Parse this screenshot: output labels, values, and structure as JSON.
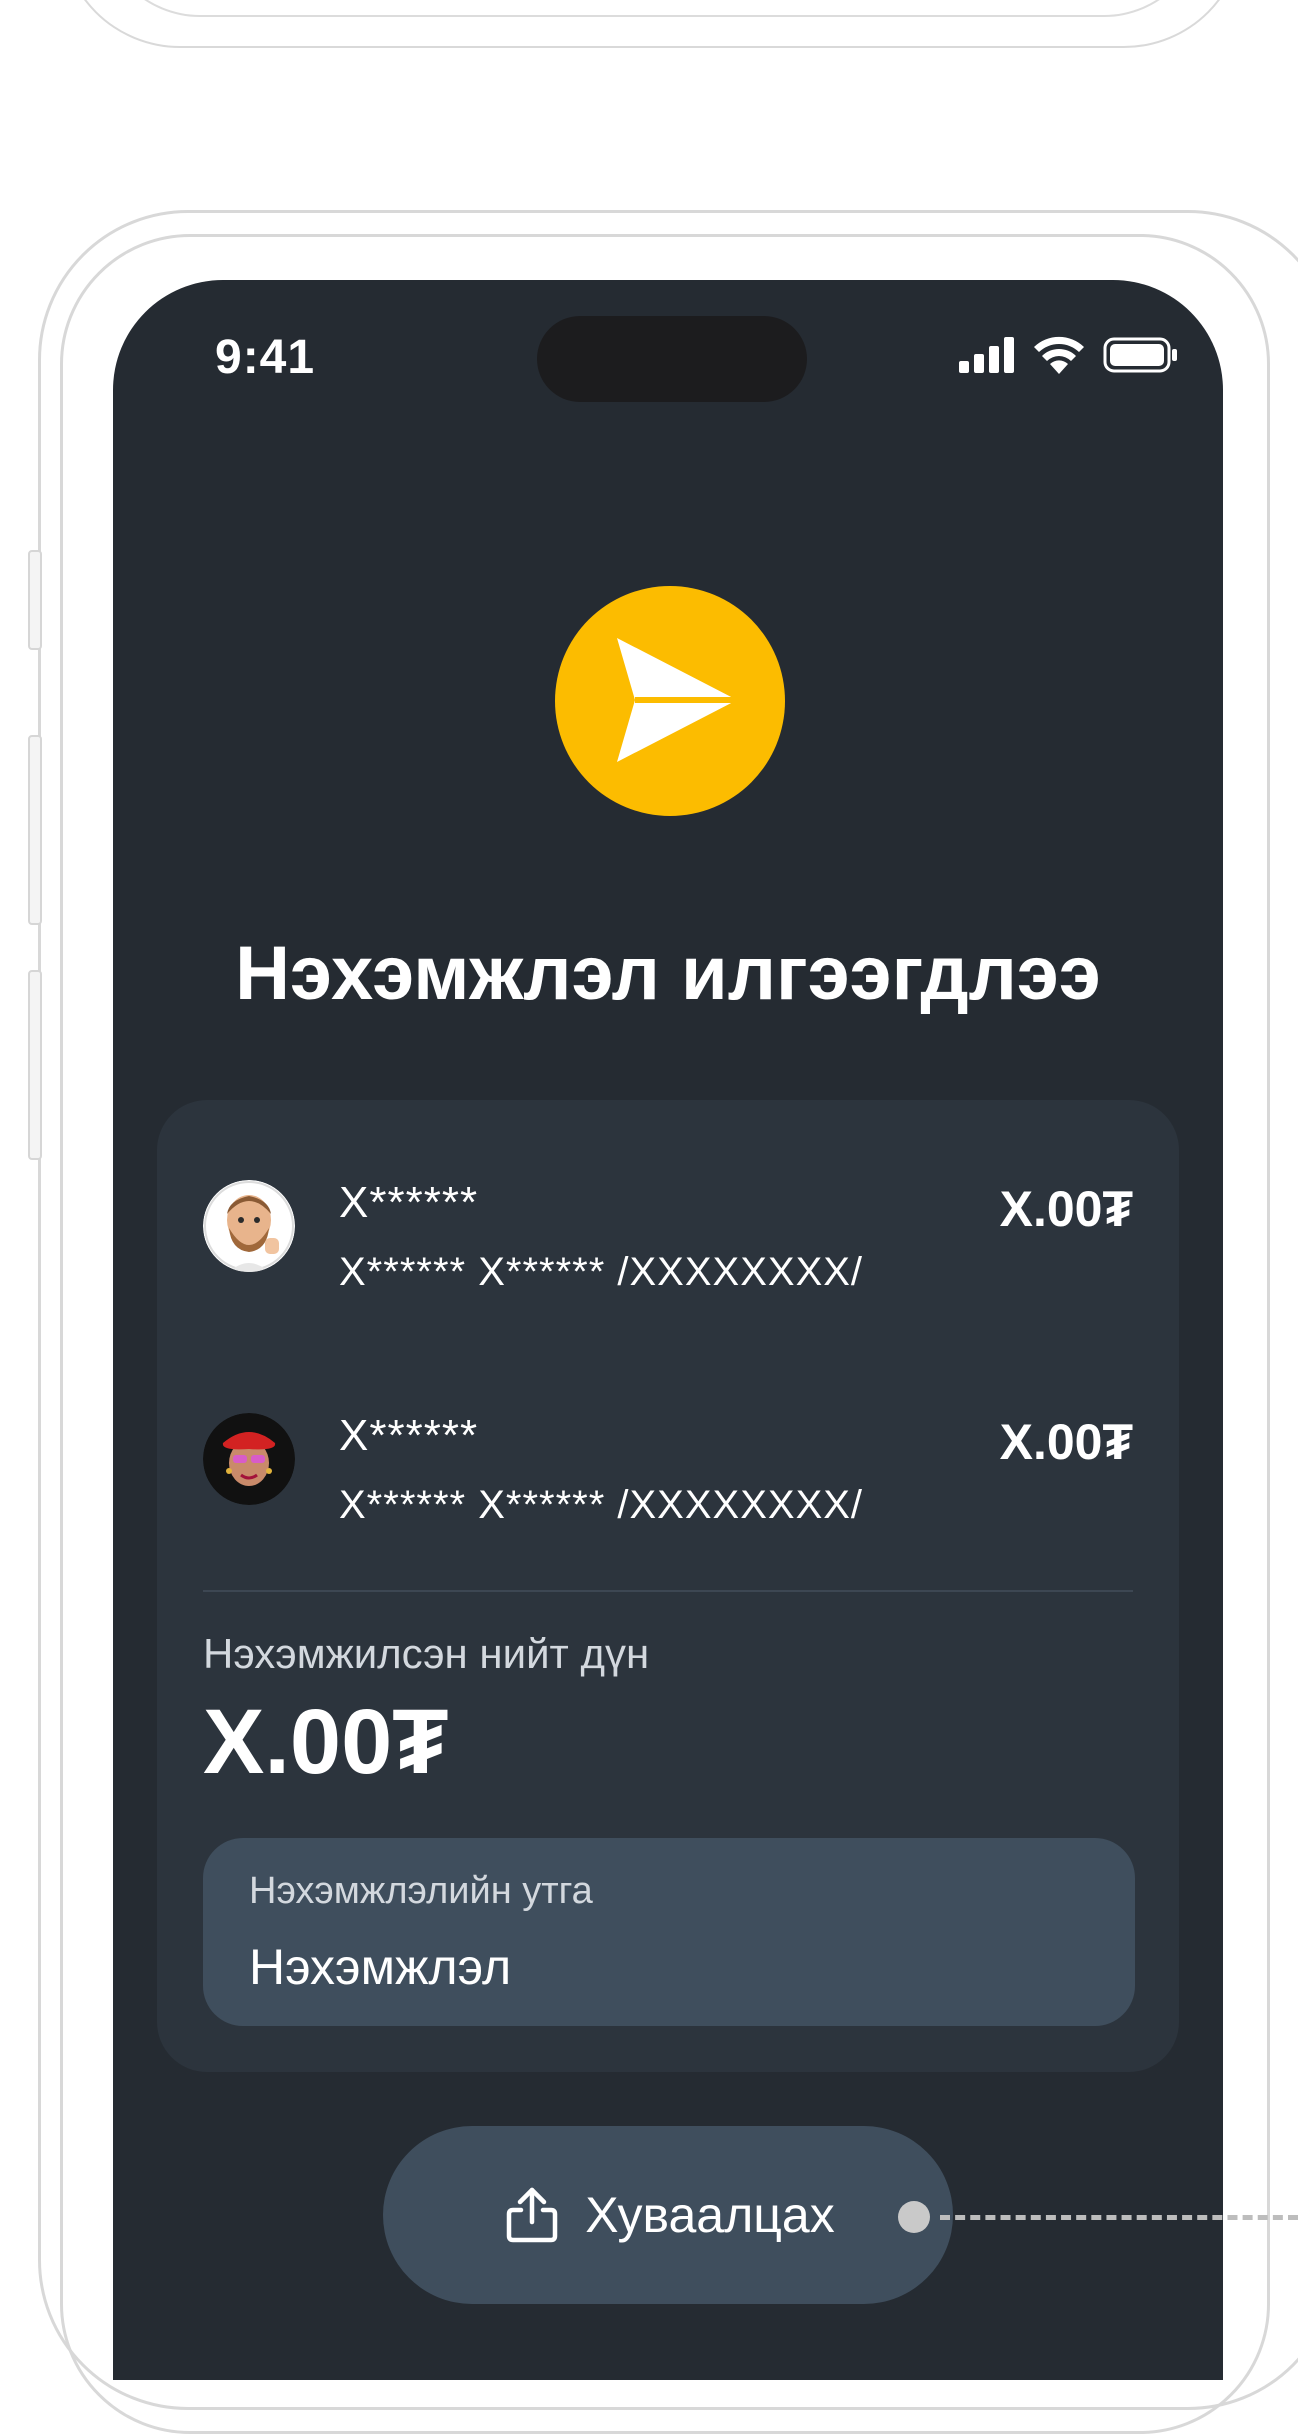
{
  "status_bar": {
    "time": "9:41"
  },
  "page": {
    "title": "Нэхэмжлэл илгээгдлээ"
  },
  "recipients": [
    {
      "name": "X******",
      "account": "X****** X****** /XXXXXXXX/",
      "amount": "X.00₮",
      "avatar": "memoji-man-thumbs-up"
    },
    {
      "name": "X******",
      "account": "X****** X****** /XXXXXXXX/",
      "amount": "X.00₮",
      "avatar": "memoji-woman-red-beret"
    }
  ],
  "total": {
    "label": "Нэхэмжилсэн нийт дүн",
    "value": "X.00₮"
  },
  "description": {
    "label": "Нэхэмжлэлийн утга",
    "value": "Нэхэмжлэл"
  },
  "share_button": {
    "label": "Хуваалцах",
    "icon": "share-icon"
  },
  "colors": {
    "screen_bg": "#252b32",
    "card_bg": "#2c343d",
    "accent": "#fcbc00",
    "field_bg": "#3f4e5d"
  }
}
